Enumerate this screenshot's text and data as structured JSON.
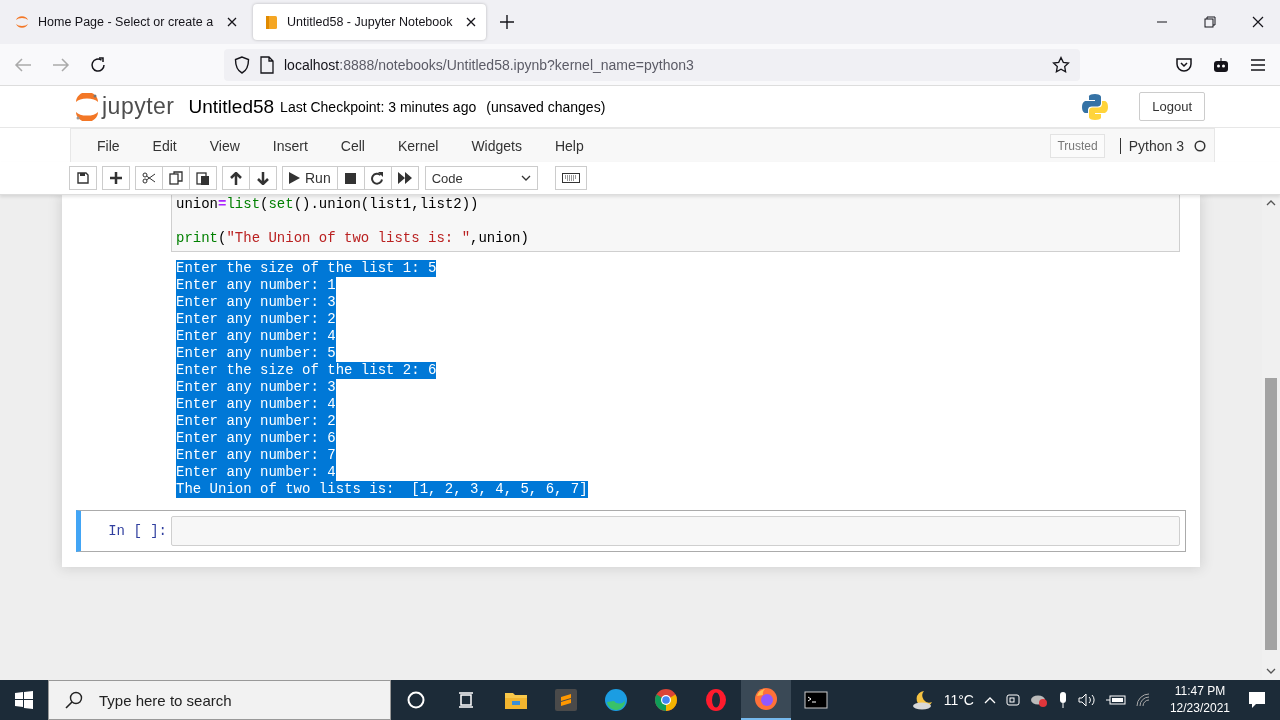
{
  "browser": {
    "tabs": [
      {
        "label": "Home Page - Select or create a",
        "selected": false,
        "kind": "jupyter"
      },
      {
        "label": "Untitled58 - Jupyter Notebook",
        "selected": true,
        "kind": "notebook"
      }
    ],
    "url_host": "localhost",
    "url_rest": ":8888/notebooks/Untitled58.ipynb?kernel_name=python3"
  },
  "header": {
    "logo_text": "jupyter",
    "title": "Untitled58",
    "checkpoint": "Last Checkpoint: 3 minutes ago",
    "status": "(unsaved changes)",
    "logout": "Logout"
  },
  "menu": [
    "File",
    "Edit",
    "View",
    "Insert",
    "Cell",
    "Kernel",
    "Widgets",
    "Help"
  ],
  "toolbar": {
    "run_label": "Run",
    "cell_type": "Code",
    "trusted": "Trusted",
    "kernel": "Python 3",
    "kernel_busy": false
  },
  "code_lines": [
    {
      "kind": "code",
      "tokens": [
        {
          "text": "union",
          "kind": "plain"
        },
        {
          "text": "=",
          "kind": "operator"
        },
        {
          "text": "list",
          "kind": "builtin"
        },
        {
          "text": "(",
          "kind": "plain"
        },
        {
          "text": "set",
          "kind": "builtin"
        },
        {
          "text": "().union(list1,list2))",
          "kind": "plain"
        }
      ]
    },
    {
      "kind": "blank"
    },
    {
      "kind": "code",
      "tokens": [
        {
          "text": "print",
          "kind": "builtin"
        },
        {
          "text": "(",
          "kind": "plain"
        },
        {
          "text": "\"The Union of two lists is: \"",
          "kind": "string"
        },
        {
          "text": ",union)",
          "kind": "plain"
        }
      ]
    }
  ],
  "output": {
    "selected": true,
    "lines": [
      "Enter the size of the list 1: 5",
      "Enter any number: 1",
      "Enter any number: 3",
      "Enter any number: 2",
      "Enter any number: 4",
      "Enter any number: 5",
      "Enter the size of the list 2: 6",
      "Enter any number: 3",
      "Enter any number: 4",
      "Enter any number: 2",
      "Enter any number: 6",
      "Enter any number: 7",
      "Enter any number: 4",
      "The Union of two lists is:  [1, 2, 3, 4, 5, 6, 7]"
    ]
  },
  "new_cell": {
    "prompt": "In [ ]:",
    "selected": true
  },
  "taskbar": {
    "search_placeholder": "Type here to search",
    "apps": [
      {
        "kind": "cortana",
        "active": false
      },
      {
        "kind": "taskview",
        "active": false
      },
      {
        "kind": "explorer",
        "active": false
      },
      {
        "kind": "sublime",
        "active": false
      },
      {
        "kind": "edge",
        "active": false
      },
      {
        "kind": "chrome",
        "active": false
      },
      {
        "kind": "opera",
        "active": false
      },
      {
        "kind": "firefox",
        "active": true
      },
      {
        "kind": "terminal",
        "active": false
      }
    ],
    "temperature": "11°C",
    "time": "11:47 PM",
    "date": "12/23/2021"
  }
}
